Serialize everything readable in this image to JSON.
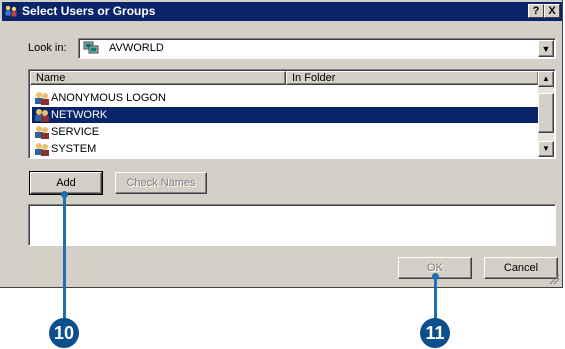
{
  "window": {
    "title": "Select Users or Groups",
    "help_button": "?",
    "close_button": "X"
  },
  "look_in": {
    "label": "Look in:",
    "value": "AVWORLD"
  },
  "list": {
    "columns": [
      "Name",
      "In Folder"
    ],
    "rows": [
      {
        "name": "ANONYMOUS LOGON",
        "folder": "",
        "selected": false
      },
      {
        "name": "NETWORK",
        "folder": "",
        "selected": true
      },
      {
        "name": "SERVICE",
        "folder": "",
        "selected": false
      },
      {
        "name": "SYSTEM",
        "folder": "",
        "selected": false
      }
    ]
  },
  "buttons": {
    "add": "Add",
    "check_names": "Check Names",
    "ok": "OK",
    "cancel": "Cancel"
  },
  "callouts": [
    "10",
    "11"
  ],
  "colors": {
    "title_bar": "#0a246a",
    "selection": "#0a246a",
    "dialog_face": "#d4d0c8",
    "callout": "#0b4f8c"
  }
}
